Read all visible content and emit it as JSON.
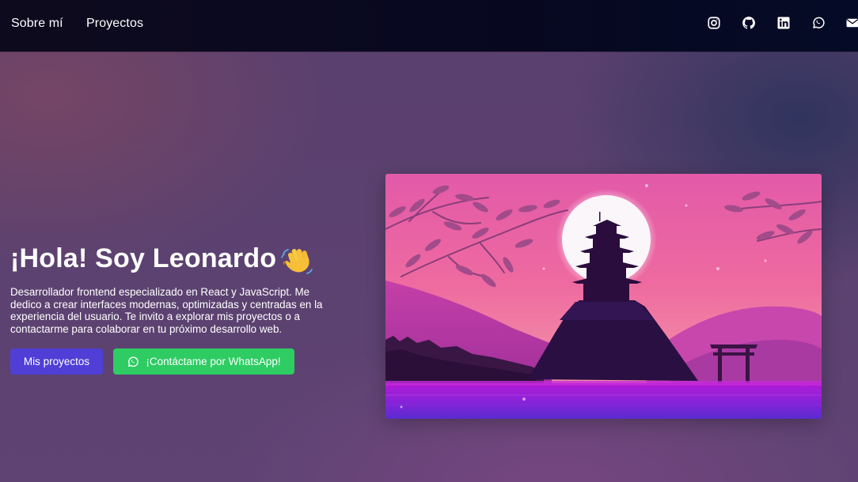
{
  "nav": {
    "links": [
      {
        "label": "Sobre mí"
      },
      {
        "label": "Proyectos"
      }
    ],
    "social_icons": [
      "instagram-icon",
      "github-icon",
      "linkedin-icon",
      "whatsapp-icon",
      "email-icon"
    ]
  },
  "hero": {
    "title": "¡Hola! Soy Leonardo",
    "emoji": "👋",
    "description": "Desarrollador frontend especializado en React y JavaScript. Me dedico a crear interfaces modernas, optimizadas y centradas en la experiencia del usuario. Te invito a explorar mis proyectos o a contactarme para colaborar en tu próximo desarrollo web.",
    "primary_button": "Mis proyectos",
    "whatsapp_button": "¡Contáctame por WhatsApp!"
  },
  "colors": {
    "primary_button": "#4f3fd6",
    "whatsapp_button": "#2ecc63",
    "navbar": "#0a0920"
  }
}
